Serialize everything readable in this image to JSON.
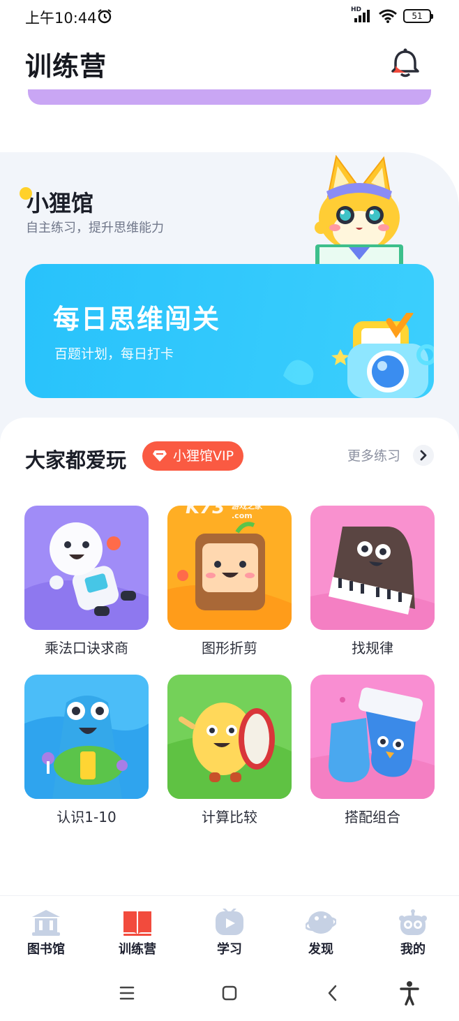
{
  "status_bar": {
    "time": "上午10:44",
    "network": "HD",
    "battery": "51"
  },
  "header": {
    "title": "训练营"
  },
  "xiaoli": {
    "title": "小狸馆",
    "subtitle": "自主练习，提升思维能力",
    "card_title": "每日思维闯关",
    "card_subtitle": "百题计划，每日打卡"
  },
  "popular": {
    "title": "大家都爱玩",
    "vip_badge": "小狸馆VIP",
    "more_link": "更多练习",
    "games": [
      {
        "label": "乘法口诀求商",
        "color": "#a08cf7"
      },
      {
        "label": "图形折剪",
        "color": "#ffae24"
      },
      {
        "label": "找规律",
        "color": "#f991cf"
      },
      {
        "label": "认识1-10",
        "color": "#4bbdf8"
      },
      {
        "label": "计算比较",
        "color": "#74d159"
      },
      {
        "label": "搭配组合",
        "color": "#f98ed2"
      }
    ]
  },
  "watermark": {
    "brand": "K73",
    "tagline": "游戏之家",
    "domain": ".com"
  },
  "bottom_nav": {
    "items": [
      {
        "label": "图书馆",
        "icon": "library-icon",
        "active": false
      },
      {
        "label": "训练营",
        "icon": "book-icon",
        "active": true
      },
      {
        "label": "学习",
        "icon": "video-icon",
        "active": false
      },
      {
        "label": "发现",
        "icon": "planet-icon",
        "active": false
      },
      {
        "label": "我的",
        "icon": "robot-icon",
        "active": false
      }
    ]
  },
  "colors": {
    "accent_blue": "#28c2fb",
    "vip_red": "#fa5a42",
    "nav_inactive": "#c6d1e4",
    "nav_active": "#f24b3d"
  }
}
